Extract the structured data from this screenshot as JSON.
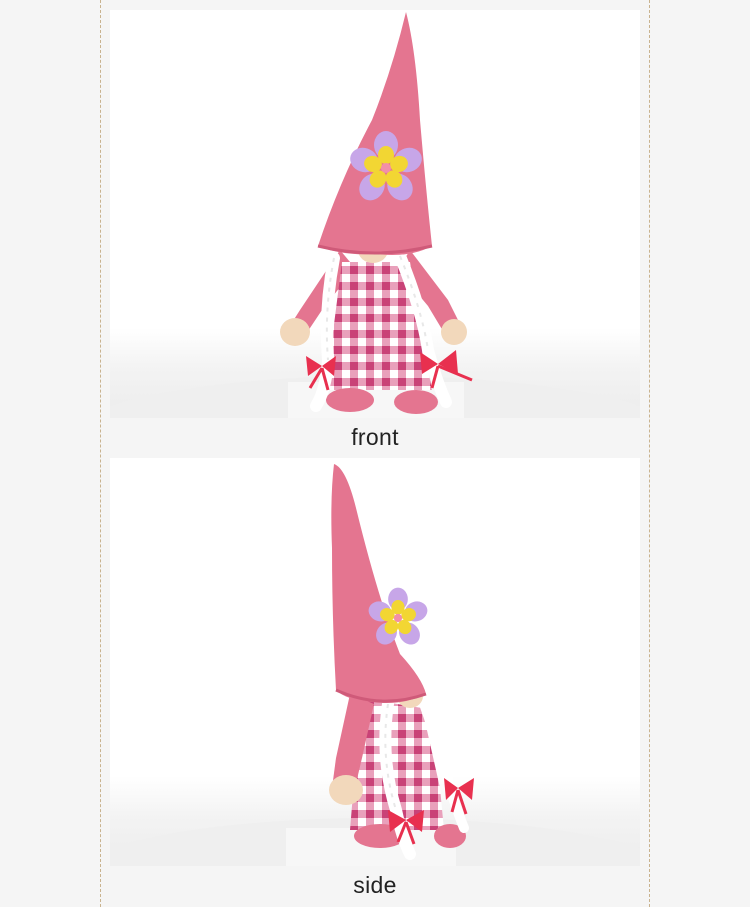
{
  "images": [
    {
      "name": "front",
      "caption": "front",
      "icon": "pink-gnome-front-image"
    },
    {
      "name": "side",
      "caption": "side",
      "icon": "pink-gnome-side-image"
    }
  ],
  "colors": {
    "background": "#f5f5f5",
    "guide": "#c9b38f",
    "hat": "#e47590",
    "body": "#e8799a",
    "gingham": "#d04d7c",
    "flower_petal": "#c7a6e8",
    "flower_center": "#f2d633",
    "ribbon": "#e8304f",
    "nose": "#f2d8bb",
    "braid": "#ffffff"
  }
}
